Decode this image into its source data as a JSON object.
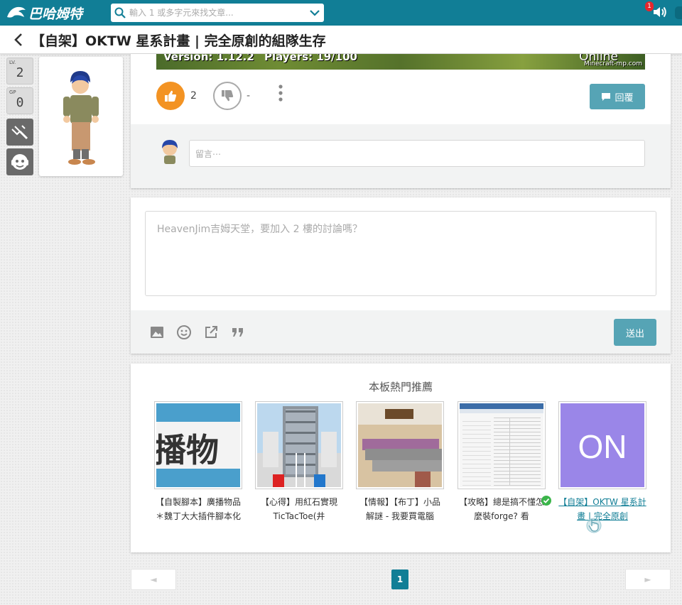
{
  "topbar": {
    "logo_text": "巴哈姆特",
    "search_placeholder": "輸入 1 或多字元來找文章...",
    "notification_count": "1",
    "colors": {
      "bar": "#117e96",
      "notification": "#e5262d"
    }
  },
  "header": {
    "title": "【自架】OKTW 星系計畫 | 完全原創的組隊生存"
  },
  "sidebar": {
    "level_label": "LV.",
    "level_value": "2",
    "gp_label": "GP",
    "gp_value": "0",
    "tools": [
      "wrench-icon",
      "mascot-icon"
    ]
  },
  "post": {
    "banner": {
      "version": "Version: 1.12.2",
      "players": "Players: 19/100",
      "status": "Online",
      "site": "Minecraft-mp.com"
    },
    "like_count": "2",
    "dislike_count": "-",
    "reply_label": "回覆",
    "comment_placeholder": "留言⋯"
  },
  "reply_box": {
    "placeholder": "HeavenJim吉姆天堂，要加入 2 樓的討論嗎？",
    "toolbar": [
      "image-icon",
      "emoji-icon",
      "external-link-icon",
      "quote-icon"
    ],
    "send_label": "送出"
  },
  "recommendations": {
    "title": "本板熱門推薦",
    "items": [
      {
        "label": "【自製腳本】廣播物品＊魏丁大大插件腳本化",
        "thumb_text": "播物",
        "thumb_color": "#4a9fcc"
      },
      {
        "label": "【心得】用紅石實現TicTacToe(井",
        "thumb_text": "",
        "thumb_color": "#bcd8ee"
      },
      {
        "label": "【情報】【布丁】小品解謎 - 我要買電腦",
        "thumb_text": "",
        "thumb_color": "#d8c3a2"
      },
      {
        "label": "【攻略】總是搞不懂怎麼裝forge? 看",
        "thumb_text": "",
        "thumb_color": "#f4f4f4"
      },
      {
        "label": "【自架】OKTW 星系計畫 | 完全原創",
        "thumb_text": "ON",
        "thumb_color": "#9a86e8"
      }
    ]
  },
  "pagination": {
    "prev": "◄",
    "current": "1",
    "next": "►"
  }
}
